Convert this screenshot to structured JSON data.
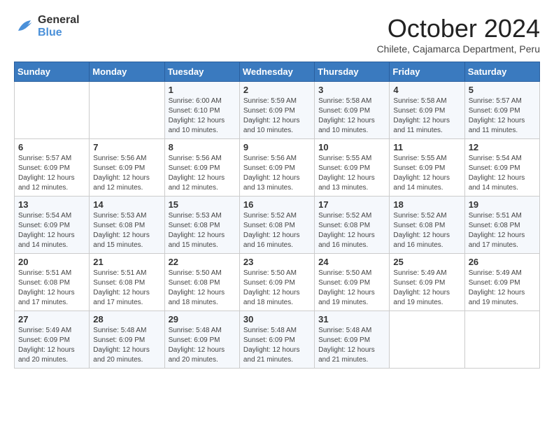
{
  "logo": {
    "line1": "General",
    "line2": "Blue"
  },
  "title": "October 2024",
  "subtitle": "Chilete, Cajamarca Department, Peru",
  "days_of_week": [
    "Sunday",
    "Monday",
    "Tuesday",
    "Wednesday",
    "Thursday",
    "Friday",
    "Saturday"
  ],
  "weeks": [
    [
      {
        "day": "",
        "info": ""
      },
      {
        "day": "",
        "info": ""
      },
      {
        "day": "1",
        "sunrise": "Sunrise: 6:00 AM",
        "sunset": "Sunset: 6:10 PM",
        "daylight": "Daylight: 12 hours and 10 minutes."
      },
      {
        "day": "2",
        "sunrise": "Sunrise: 5:59 AM",
        "sunset": "Sunset: 6:09 PM",
        "daylight": "Daylight: 12 hours and 10 minutes."
      },
      {
        "day": "3",
        "sunrise": "Sunrise: 5:58 AM",
        "sunset": "Sunset: 6:09 PM",
        "daylight": "Daylight: 12 hours and 10 minutes."
      },
      {
        "day": "4",
        "sunrise": "Sunrise: 5:58 AM",
        "sunset": "Sunset: 6:09 PM",
        "daylight": "Daylight: 12 hours and 11 minutes."
      },
      {
        "day": "5",
        "sunrise": "Sunrise: 5:57 AM",
        "sunset": "Sunset: 6:09 PM",
        "daylight": "Daylight: 12 hours and 11 minutes."
      }
    ],
    [
      {
        "day": "6",
        "sunrise": "Sunrise: 5:57 AM",
        "sunset": "Sunset: 6:09 PM",
        "daylight": "Daylight: 12 hours and 12 minutes."
      },
      {
        "day": "7",
        "sunrise": "Sunrise: 5:56 AM",
        "sunset": "Sunset: 6:09 PM",
        "daylight": "Daylight: 12 hours and 12 minutes."
      },
      {
        "day": "8",
        "sunrise": "Sunrise: 5:56 AM",
        "sunset": "Sunset: 6:09 PM",
        "daylight": "Daylight: 12 hours and 12 minutes."
      },
      {
        "day": "9",
        "sunrise": "Sunrise: 5:56 AM",
        "sunset": "Sunset: 6:09 PM",
        "daylight": "Daylight: 12 hours and 13 minutes."
      },
      {
        "day": "10",
        "sunrise": "Sunrise: 5:55 AM",
        "sunset": "Sunset: 6:09 PM",
        "daylight": "Daylight: 12 hours and 13 minutes."
      },
      {
        "day": "11",
        "sunrise": "Sunrise: 5:55 AM",
        "sunset": "Sunset: 6:09 PM",
        "daylight": "Daylight: 12 hours and 14 minutes."
      },
      {
        "day": "12",
        "sunrise": "Sunrise: 5:54 AM",
        "sunset": "Sunset: 6:09 PM",
        "daylight": "Daylight: 12 hours and 14 minutes."
      }
    ],
    [
      {
        "day": "13",
        "sunrise": "Sunrise: 5:54 AM",
        "sunset": "Sunset: 6:09 PM",
        "daylight": "Daylight: 12 hours and 14 minutes."
      },
      {
        "day": "14",
        "sunrise": "Sunrise: 5:53 AM",
        "sunset": "Sunset: 6:08 PM",
        "daylight": "Daylight: 12 hours and 15 minutes."
      },
      {
        "day": "15",
        "sunrise": "Sunrise: 5:53 AM",
        "sunset": "Sunset: 6:08 PM",
        "daylight": "Daylight: 12 hours and 15 minutes."
      },
      {
        "day": "16",
        "sunrise": "Sunrise: 5:52 AM",
        "sunset": "Sunset: 6:08 PM",
        "daylight": "Daylight: 12 hours and 16 minutes."
      },
      {
        "day": "17",
        "sunrise": "Sunrise: 5:52 AM",
        "sunset": "Sunset: 6:08 PM",
        "daylight": "Daylight: 12 hours and 16 minutes."
      },
      {
        "day": "18",
        "sunrise": "Sunrise: 5:52 AM",
        "sunset": "Sunset: 6:08 PM",
        "daylight": "Daylight: 12 hours and 16 minutes."
      },
      {
        "day": "19",
        "sunrise": "Sunrise: 5:51 AM",
        "sunset": "Sunset: 6:08 PM",
        "daylight": "Daylight: 12 hours and 17 minutes."
      }
    ],
    [
      {
        "day": "20",
        "sunrise": "Sunrise: 5:51 AM",
        "sunset": "Sunset: 6:08 PM",
        "daylight": "Daylight: 12 hours and 17 minutes."
      },
      {
        "day": "21",
        "sunrise": "Sunrise: 5:51 AM",
        "sunset": "Sunset: 6:08 PM",
        "daylight": "Daylight: 12 hours and 17 minutes."
      },
      {
        "day": "22",
        "sunrise": "Sunrise: 5:50 AM",
        "sunset": "Sunset: 6:08 PM",
        "daylight": "Daylight: 12 hours and 18 minutes."
      },
      {
        "day": "23",
        "sunrise": "Sunrise: 5:50 AM",
        "sunset": "Sunset: 6:09 PM",
        "daylight": "Daylight: 12 hours and 18 minutes."
      },
      {
        "day": "24",
        "sunrise": "Sunrise: 5:50 AM",
        "sunset": "Sunset: 6:09 PM",
        "daylight": "Daylight: 12 hours and 19 minutes."
      },
      {
        "day": "25",
        "sunrise": "Sunrise: 5:49 AM",
        "sunset": "Sunset: 6:09 PM",
        "daylight": "Daylight: 12 hours and 19 minutes."
      },
      {
        "day": "26",
        "sunrise": "Sunrise: 5:49 AM",
        "sunset": "Sunset: 6:09 PM",
        "daylight": "Daylight: 12 hours and 19 minutes."
      }
    ],
    [
      {
        "day": "27",
        "sunrise": "Sunrise: 5:49 AM",
        "sunset": "Sunset: 6:09 PM",
        "daylight": "Daylight: 12 hours and 20 minutes."
      },
      {
        "day": "28",
        "sunrise": "Sunrise: 5:48 AM",
        "sunset": "Sunset: 6:09 PM",
        "daylight": "Daylight: 12 hours and 20 minutes."
      },
      {
        "day": "29",
        "sunrise": "Sunrise: 5:48 AM",
        "sunset": "Sunset: 6:09 PM",
        "daylight": "Daylight: 12 hours and 20 minutes."
      },
      {
        "day": "30",
        "sunrise": "Sunrise: 5:48 AM",
        "sunset": "Sunset: 6:09 PM",
        "daylight": "Daylight: 12 hours and 21 minutes."
      },
      {
        "day": "31",
        "sunrise": "Sunrise: 5:48 AM",
        "sunset": "Sunset: 6:09 PM",
        "daylight": "Daylight: 12 hours and 21 minutes."
      },
      {
        "day": "",
        "info": ""
      },
      {
        "day": "",
        "info": ""
      }
    ]
  ]
}
